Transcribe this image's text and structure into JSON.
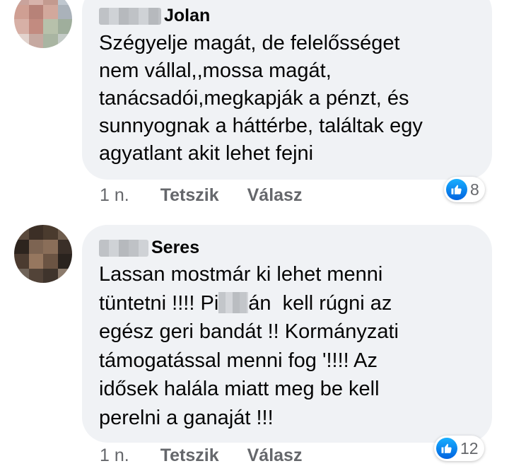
{
  "comments": [
    {
      "author_suffix": "Jolan",
      "lines": [
        "Szégyelje magát, de felelősséget",
        "nem vállal,,mossa magát,",
        "tanácsadói,megkapják a pénzt, és",
        "sunnyognak a háttérbe, találtak egy",
        "agyatlant akit lehet fejni"
      ],
      "time": "1 n.",
      "like_label": "Tetszik",
      "reply_label": "Válasz",
      "reaction_icon": "like-icon",
      "reaction_count": "8"
    },
    {
      "author_suffix": "Seres",
      "lines": [
        "Lassan mostmár ki lehet menni",
        "tüntetni !!!! Pi",
        "án  kell rúgni az",
        "egész geri bandát !! Kormányzati",
        "támogatással menni fog '!!!! Az",
        "idősek halála miatt meg be kell",
        "perelni a ganaját !!!"
      ],
      "time": "1 n.",
      "like_label": "Tetszik",
      "reply_label": "Válasz",
      "reaction_icon": "like-icon",
      "reaction_count": "12"
    }
  ],
  "colors": {
    "bubble": "#f0f2f5",
    "meta_text": "#65676b",
    "like_blue": "#1877f2"
  }
}
